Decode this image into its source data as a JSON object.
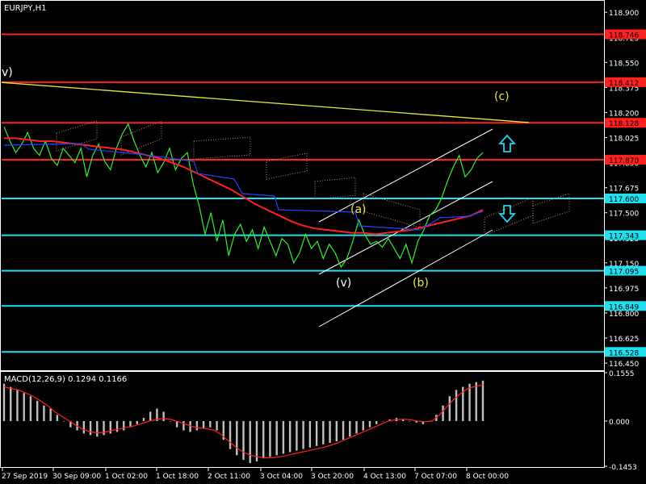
{
  "chart_data": [
    {
      "type": "line",
      "title": "EURJPY,H1",
      "symbol": "EURJPY",
      "timeframe": "H1",
      "grid": false,
      "background": "#000000",
      "ylim": [
        116.4,
        118.98
      ],
      "y_ticks": [
        {
          "label": "118.900",
          "value": 118.9
        },
        {
          "label": "118.725",
          "value": 118.725
        },
        {
          "label": "118.550",
          "value": 118.55
        },
        {
          "label": "118.375",
          "value": 118.375
        },
        {
          "label": "118.200",
          "value": 118.2
        },
        {
          "label": "118.025",
          "value": 118.025
        },
        {
          "label": "117.850",
          "value": 117.85
        },
        {
          "label": "117.675",
          "value": 117.675
        },
        {
          "label": "117.500",
          "value": 117.5
        },
        {
          "label": "117.325",
          "value": 117.325
        },
        {
          "label": "117.150",
          "value": 117.15
        },
        {
          "label": "116.975",
          "value": 116.975
        },
        {
          "label": "116.800",
          "value": 116.8
        },
        {
          "label": "116.625",
          "value": 116.625
        },
        {
          "label": "116.450",
          "value": 116.45
        }
      ],
      "horizontal_levels": [
        {
          "label": "118.746",
          "value": 118.746,
          "color": "#ff2020"
        },
        {
          "label": "118.412",
          "value": 118.412,
          "color": "#ff2020"
        },
        {
          "label": "118.128",
          "value": 118.128,
          "color": "#ff2020"
        },
        {
          "label": "117.870",
          "value": 117.87,
          "color": "#ff2020"
        },
        {
          "label": "117.600",
          "value": 117.6,
          "color": "#20e0f0"
        },
        {
          "label": "117.343",
          "value": 117.343,
          "color": "#20e0f0"
        },
        {
          "label": "117.095",
          "value": 117.095,
          "color": "#20e0f0"
        },
        {
          "label": "116.849",
          "value": 116.849,
          "color": "#20e0f0"
        },
        {
          "label": "116.528",
          "value": 116.528,
          "color": "#20e0f0"
        }
      ],
      "wave_labels": [
        {
          "text": "v)",
          "color": "#ffffff"
        },
        {
          "text": "(a)",
          "color": "#e8e840"
        },
        {
          "text": "(v)",
          "color": "#ffffff"
        },
        {
          "text": "(b)",
          "color": "#e8e840"
        },
        {
          "text": "(c)",
          "color": "#e8e840"
        }
      ],
      "arrows": [
        {
          "direction": "up",
          "color": "#20d0f0"
        },
        {
          "direction": "down",
          "color": "#20d0f0"
        }
      ],
      "series": [
        {
          "style": "price",
          "color": "#33ee33",
          "values": [
            118.1,
            118.0,
            117.92,
            117.98,
            118.06,
            117.95,
            117.9,
            118.0,
            117.88,
            117.83,
            117.95,
            117.9,
            117.85,
            117.95,
            117.75,
            117.9,
            117.98,
            117.86,
            117.8,
            117.95,
            118.05,
            118.12,
            118.0,
            117.9,
            117.82,
            117.92,
            117.78,
            117.85,
            117.95,
            117.8,
            117.88,
            117.92,
            117.7,
            117.55,
            117.35,
            117.5,
            117.3,
            117.45,
            117.2,
            117.35,
            117.42,
            117.3,
            117.38,
            117.25,
            117.4,
            117.3,
            117.2,
            117.32,
            117.28,
            117.15,
            117.22,
            117.35,
            117.25,
            117.3,
            117.18,
            117.28,
            117.22,
            117.12,
            117.18,
            117.3,
            117.45,
            117.35,
            117.28,
            117.3,
            117.26,
            117.32,
            117.25,
            117.18,
            117.28,
            117.15,
            117.3,
            117.38,
            117.48,
            117.52,
            117.6,
            117.72,
            117.82,
            117.9,
            117.75,
            117.8,
            117.88,
            117.92
          ]
        },
        {
          "style": "ma-red",
          "color": "#ff2020",
          "values": [
            118.02,
            118.02,
            118.01,
            118.0,
            118.0,
            117.99,
            117.98,
            117.97,
            117.96,
            117.95,
            117.94,
            117.92,
            117.9,
            117.88,
            117.85,
            117.82,
            117.78,
            117.74,
            117.7,
            117.66,
            117.61,
            117.56,
            117.52,
            117.48,
            117.44,
            117.41,
            117.39,
            117.38,
            117.37,
            117.36,
            117.36,
            117.35,
            117.36,
            117.37,
            117.38,
            117.4,
            117.42,
            117.44,
            117.46,
            117.48,
            117.52
          ]
        },
        {
          "style": "yellow-trend",
          "color": "#e8e840",
          "values": [
            118.41,
            118.13
          ]
        }
      ]
    },
    {
      "type": "bar",
      "title": "MACD(12,26,9) 0.1294 0.1166",
      "ylim": [
        -0.1453,
        0.1555
      ],
      "y_ticks": [
        {
          "label": "0.1555",
          "value": 0.1555
        },
        {
          "label": "0.000",
          "value": 0.0
        },
        {
          "label": "-0.1453",
          "value": -0.1453
        }
      ],
      "x_ticks": [
        "27 Sep 2019",
        "30 Sep 09:00",
        "1 Oct 02:00",
        "1 Oct 18:00",
        "2 Oct 11:00",
        "3 Oct 04:00",
        "3 Oct 20:00",
        "4 Oct 13:00",
        "7 Oct 07:00",
        "8 Oct 00:00"
      ],
      "series": [
        {
          "name": "",
          "style": "histogram",
          "color": "#c0c0c0",
          "values": [
            0.12,
            0.11,
            0.1,
            0.09,
            0.08,
            0.065,
            0.05,
            0.04,
            0.02,
            0.0,
            -0.02,
            -0.03,
            -0.04,
            -0.045,
            -0.05,
            -0.045,
            -0.04,
            -0.035,
            -0.03,
            -0.02,
            -0.01,
            0.01,
            0.03,
            0.04,
            0.03,
            0.0,
            -0.02,
            -0.03,
            -0.035,
            -0.03,
            -0.025,
            -0.02,
            -0.03,
            -0.06,
            -0.09,
            -0.11,
            -0.125,
            -0.135,
            -0.13,
            -0.12,
            -0.115,
            -0.11,
            -0.105,
            -0.1,
            -0.095,
            -0.09,
            -0.085,
            -0.08,
            -0.075,
            -0.07,
            -0.065,
            -0.06,
            -0.05,
            -0.04,
            -0.03,
            -0.02,
            -0.01,
            0.0,
            0.005,
            0.01,
            0.005,
            0.0,
            -0.005,
            -0.01,
            0.0,
            0.02,
            0.05,
            0.08,
            0.1,
            0.11,
            0.12,
            0.125,
            0.13
          ]
        },
        {
          "name": "",
          "style": "signal",
          "color": "#ff2020",
          "values": [
            0.11,
            0.105,
            0.1,
            0.09,
            0.08,
            0.065,
            0.05,
            0.03,
            0.015,
            0.0,
            -0.015,
            -0.028,
            -0.035,
            -0.038,
            -0.035,
            -0.03,
            -0.025,
            -0.02,
            -0.015,
            -0.008,
            0.0,
            0.005,
            0.008,
            0.005,
            -0.002,
            -0.01,
            -0.018,
            -0.022,
            -0.025,
            -0.03,
            -0.045,
            -0.065,
            -0.085,
            -0.1,
            -0.11,
            -0.115,
            -0.118,
            -0.118,
            -0.115,
            -0.11,
            -0.105,
            -0.1,
            -0.095,
            -0.09,
            -0.085,
            -0.078,
            -0.07,
            -0.06,
            -0.05,
            -0.04,
            -0.03,
            -0.02,
            -0.01,
            0.0,
            0.004,
            0.006,
            0.004,
            0.0,
            -0.002,
            0.0,
            0.02,
            0.045,
            0.07,
            0.09,
            0.105,
            0.112,
            0.1166
          ]
        }
      ]
    }
  ]
}
